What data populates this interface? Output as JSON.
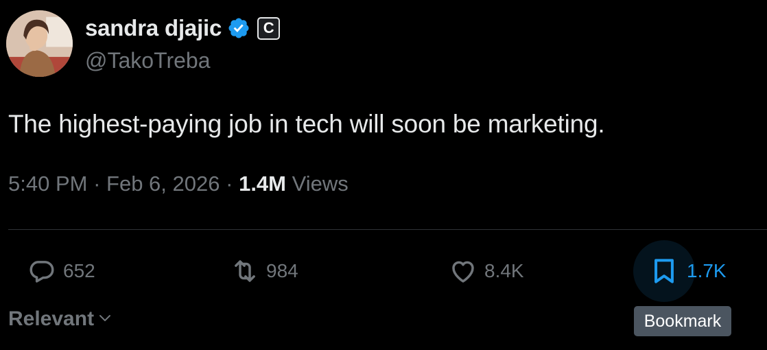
{
  "author": {
    "name": "sandra djajic",
    "handle": "@TakoTreba",
    "affiliate_badge_letter": "C",
    "avatar_icon": "profile-photo",
    "verified_color": "#1d9bf0"
  },
  "post": {
    "text": "The highest-paying job in tech will soon be marketing.",
    "time": "5:40 PM",
    "date": "Feb 6, 2026",
    "separator": "·",
    "views_count": "1.4M",
    "views_label": "Views"
  },
  "actions": {
    "reply": {
      "icon": "reply-icon",
      "count": "652"
    },
    "retweet": {
      "icon": "retweet-icon",
      "count": "984"
    },
    "like": {
      "icon": "heart-icon",
      "count": "8.4K"
    },
    "bookmark": {
      "icon": "bookmark-icon",
      "count": "1.7K"
    }
  },
  "sort": {
    "label": "Relevant"
  },
  "tooltip": {
    "label": "Bookmark"
  },
  "colors": {
    "background": "#000000",
    "text": "#e7e9ea",
    "muted": "#71767b",
    "accent": "#1d9bf0",
    "divider": "#2f3336"
  }
}
